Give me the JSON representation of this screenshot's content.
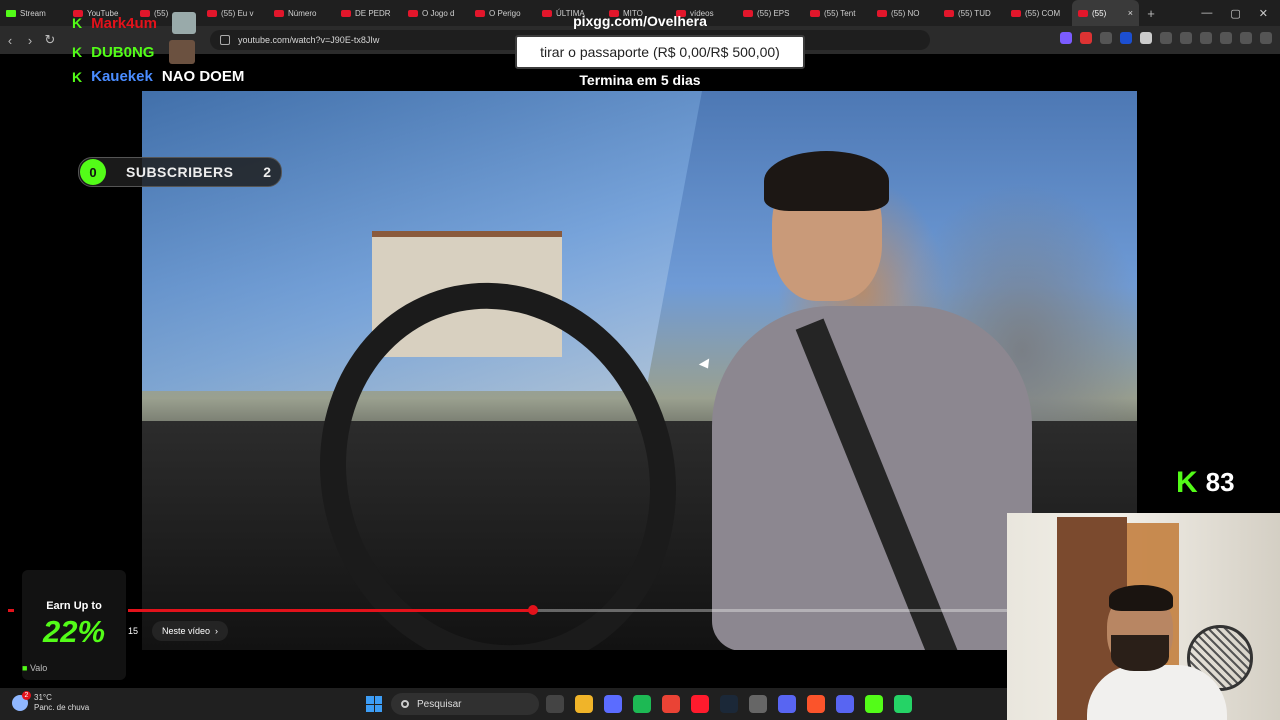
{
  "browser": {
    "tabs": [
      {
        "label": "Stream",
        "favicon": "kick",
        "active": false
      },
      {
        "label": "YouTube",
        "favicon": "youtube",
        "active": false
      },
      {
        "label": "(55)",
        "favicon": "youtube",
        "active": false
      },
      {
        "label": "(55) Eu v",
        "favicon": "youtube",
        "active": false
      },
      {
        "label": "Número",
        "favicon": "youtube",
        "active": false
      },
      {
        "label": "DE PEDR",
        "favicon": "youtube",
        "active": false
      },
      {
        "label": "O Jogo d",
        "favicon": "youtube",
        "active": false
      },
      {
        "label": "O Perigo",
        "favicon": "youtube",
        "active": false
      },
      {
        "label": "ÚLTIMA",
        "favicon": "youtube",
        "active": false
      },
      {
        "label": "MITO",
        "favicon": "youtube",
        "active": false
      },
      {
        "label": "vídeos",
        "favicon": "youtube",
        "active": false
      },
      {
        "label": "(55) EPS",
        "favicon": "youtube",
        "active": false
      },
      {
        "label": "(55) Tent",
        "favicon": "youtube",
        "active": false
      },
      {
        "label": "(55) NO",
        "favicon": "youtube",
        "active": false
      },
      {
        "label": "(55) TUD",
        "favicon": "youtube",
        "active": false
      },
      {
        "label": "(55) COM",
        "favicon": "youtube",
        "active": false
      },
      {
        "label": "(55)",
        "favicon": "youtube",
        "active": true
      }
    ],
    "new_tab_label": "+",
    "close_tab_label": "×",
    "window_controls": {
      "minimize": "—",
      "maximize": "▢",
      "close": "✕"
    },
    "nav": {
      "back": "‹",
      "forward": "›",
      "reload": "↻"
    },
    "url": "youtube.com/watch?v=J90E-tx8JIw"
  },
  "overlay": {
    "chat": [
      {
        "user": "Mark4um",
        "message": "",
        "user_color": "#e3121b"
      },
      {
        "user": "DUB0NG",
        "message": "",
        "user_color": "#53fc18"
      },
      {
        "user": "Kauekek",
        "message": "NAO DOEM",
        "user_color": "#4a8cff"
      }
    ],
    "pix_link": "pixgg.com/Ovelhera",
    "goal_text": "tirar o passaporte (R$ 0,00/R$ 500,00)",
    "goal_ends": "Termina em 5 dias",
    "subscribers": {
      "current": "0",
      "label": "SUBSCRIBERS",
      "goal": "2"
    },
    "viewer_count": "83",
    "kick_glyph": "K",
    "earn": {
      "title": "Earn Up to",
      "percent": "22%",
      "brand": "Valo"
    }
  },
  "player": {
    "progress_fraction": 0.46,
    "time_fragment": "15",
    "chapter_label": "Neste vídeo",
    "chapter_chevron": "›"
  },
  "taskbar": {
    "weather_temp": "31°C",
    "weather_desc": "Panc. de chuva",
    "weather_badge": "2",
    "search_placeholder": "Pesquisar",
    "pinned_icons": [
      "taskview-icon",
      "file-explorer-icon",
      "apps-icon",
      "spotify-icon",
      "chrome-icon",
      "opera-icon",
      "steam-icon",
      "app-icon",
      "arrow-icon",
      "brave-icon",
      "discord-icon",
      "play-icon",
      "whatsapp-icon"
    ]
  },
  "colors": {
    "kick_green": "#53fc18",
    "youtube_red": "#e3121b"
  }
}
